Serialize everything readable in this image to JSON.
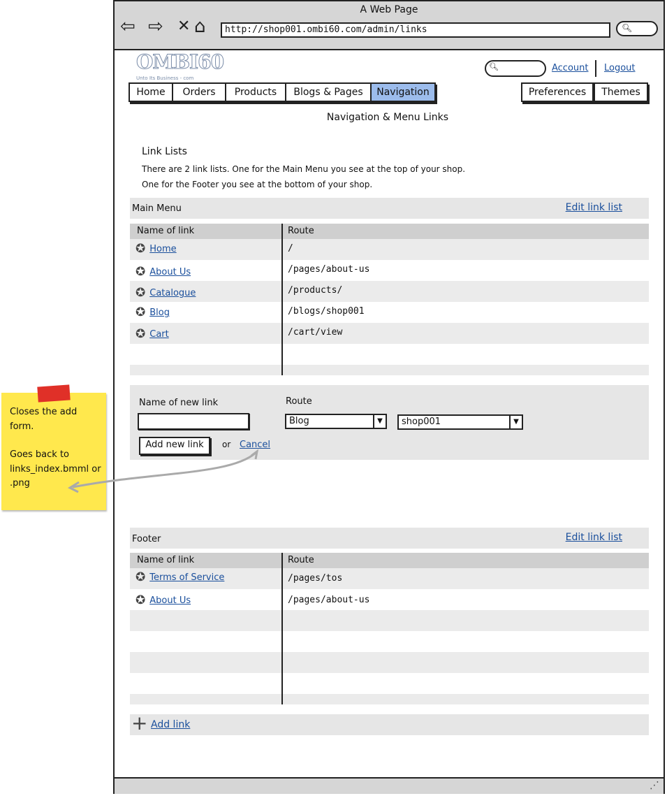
{
  "browser": {
    "window_title": "A Web Page",
    "url": "http://shop001.ombi60.com/admin/links",
    "icons": [
      "back-arrow-icon",
      "forward-arrow-icon",
      "close-x-icon",
      "home-icon",
      "search-icon"
    ]
  },
  "header": {
    "logo_text": "OMBI60",
    "logo_sub": "Unto Its Business - com",
    "account_label": "Account",
    "logout_label": "Logout"
  },
  "nav": {
    "tabs": [
      "Home",
      "Orders",
      "Products",
      "Blogs & Pages",
      "Navigation"
    ],
    "active": "Navigation",
    "right_tabs": [
      "Preferences",
      "Themes"
    ]
  },
  "page": {
    "title": "Navigation & Menu Links",
    "intro_heading": "Link Lists",
    "intro_line1": "There are 2 link lists. One for the Main Menu you see at the top of your shop.",
    "intro_line2": "One for the Footer you see at the bottom of your shop."
  },
  "main_menu": {
    "title": "Main Menu",
    "edit_label": "Edit link list",
    "col_name": "Name of link",
    "col_route": "Route",
    "rows": [
      {
        "name": "Home",
        "route": "/"
      },
      {
        "name": "About Us",
        "route": "/pages/about-us"
      },
      {
        "name": "Catalogue",
        "route": "/products/"
      },
      {
        "name": "Blog",
        "route": "/blogs/shop001"
      },
      {
        "name": "Cart",
        "route": "/cart/view"
      }
    ]
  },
  "add_form": {
    "name_label": "Name of new link",
    "name_value": "",
    "route_label": "Route",
    "route_type": "Blog",
    "route_target": "shop001",
    "add_button": "Add new link",
    "or_text": "or",
    "cancel_label": "Cancel"
  },
  "footer_menu": {
    "title": "Footer",
    "edit_label": "Edit link list",
    "col_name": "Name of link",
    "col_route": "Route",
    "rows": [
      {
        "name": "Terms of Service",
        "route": "/pages/tos"
      },
      {
        "name": "About Us",
        "route": "/pages/about-us"
      }
    ]
  },
  "add_link": {
    "label": "Add link"
  },
  "sticky_note": {
    "line1": "Closes the add",
    "line2": "form.",
    "line3": "Goes back to",
    "line4": "links_index.bmml or",
    "line5": ".png"
  }
}
